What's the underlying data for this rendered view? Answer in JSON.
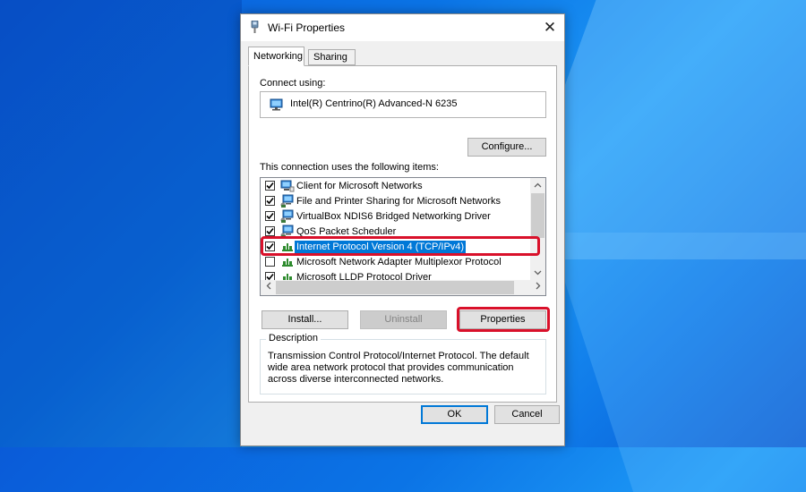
{
  "window": {
    "title": "Wi-Fi Properties",
    "close_glyph": "✕"
  },
  "tabs": [
    {
      "label": "Networking",
      "active": true
    },
    {
      "label": "Sharing",
      "active": false
    }
  ],
  "networking": {
    "connect_using_label": "Connect using:",
    "adapter_name": "Intel(R) Centrino(R) Advanced-N 6235",
    "configure_label": "Configure...",
    "items_label": "This connection uses the following items:",
    "items": [
      {
        "label": "Client for Microsoft Networks",
        "checked": true,
        "icon": "network-client-icon"
      },
      {
        "label": "File and Printer Sharing for Microsoft Networks",
        "checked": true,
        "icon": "network-service-icon"
      },
      {
        "label": "VirtualBox NDIS6 Bridged Networking Driver",
        "checked": true,
        "icon": "network-service-icon"
      },
      {
        "label": "QoS Packet Scheduler",
        "checked": true,
        "icon": "network-service-icon"
      },
      {
        "label": "Internet Protocol Version 4 (TCP/IPv4)",
        "checked": true,
        "icon": "protocol-icon",
        "selected": true
      },
      {
        "label": "Microsoft Network Adapter Multiplexor Protocol",
        "checked": false,
        "icon": "protocol-icon"
      },
      {
        "label": "Microsoft LLDP Protocol Driver",
        "checked": true,
        "icon": "protocol-icon"
      }
    ],
    "install_label": "Install...",
    "uninstall_label": "Uninstall",
    "properties_label": "Properties",
    "description_legend": "Description",
    "description_text": "Transmission Control Protocol/Internet Protocol. The default wide area network protocol that provides communication across diverse interconnected networks."
  },
  "footer": {
    "ok_label": "OK",
    "cancel_label": "Cancel"
  },
  "colors": {
    "selection": "#0078d7",
    "annotation_highlight": "#d9102a"
  }
}
